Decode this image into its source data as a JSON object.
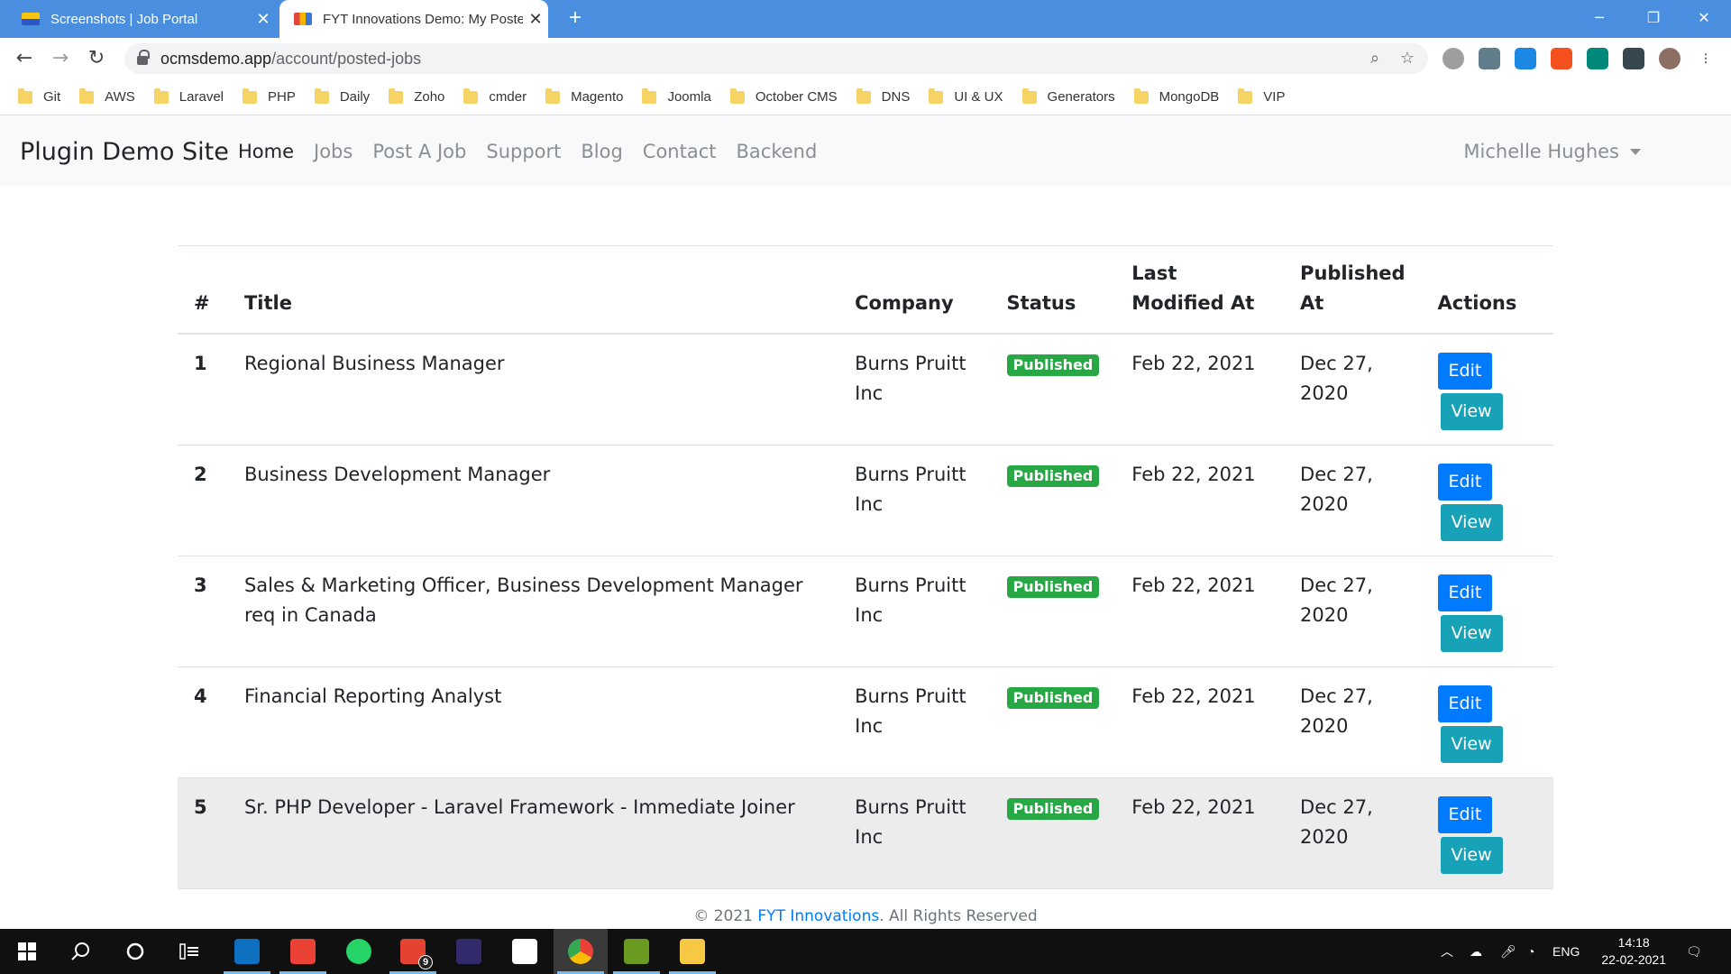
{
  "browser": {
    "tabs": [
      {
        "title": "Screenshots | Job Portal",
        "active": false
      },
      {
        "title": "FYT Innovations Demo: My Poste",
        "active": true
      }
    ],
    "new_tab": "+",
    "window_controls": {
      "minimize": "─",
      "restore": "❐",
      "close": "✕"
    },
    "url_host": "ocmsdemo.app",
    "url_path": "/account/posted-jobs",
    "bookmarks": [
      "Git",
      "AWS",
      "Laravel",
      "PHP",
      "Daily",
      "Zoho",
      "cmder",
      "Magento",
      "Joomla",
      "October CMS",
      "DNS",
      "UI & UX",
      "Generators",
      "MongoDB",
      "VIP"
    ]
  },
  "site": {
    "brand": "Plugin Demo Site",
    "nav": [
      "Home",
      "Jobs",
      "Post A Job",
      "Support",
      "Blog",
      "Contact",
      "Backend"
    ],
    "active_nav": "Home",
    "user": "Michelle Hughes"
  },
  "table": {
    "headers": [
      "#",
      "Title",
      "Company",
      "Status",
      "Last Modified At",
      "Published At",
      "Actions"
    ],
    "rows": [
      {
        "num": "1",
        "title": "Regional Business Manager",
        "company": "Burns Pruitt Inc",
        "status": "Published",
        "modified": "Feb 22, 2021",
        "published": "Dec 27, 2020"
      },
      {
        "num": "2",
        "title": "Business Development Manager",
        "company": "Burns Pruitt Inc",
        "status": "Published",
        "modified": "Feb 22, 2021",
        "published": "Dec 27, 2020"
      },
      {
        "num": "3",
        "title": "Sales & Marketing Officer, Business Development Manager req in Canada",
        "company": "Burns Pruitt Inc",
        "status": "Published",
        "modified": "Feb 22, 2021",
        "published": "Dec 27, 2020"
      },
      {
        "num": "4",
        "title": "Financial Reporting Analyst",
        "company": "Burns Pruitt Inc",
        "status": "Published",
        "modified": "Feb 22, 2021",
        "published": "Dec 27, 2020"
      },
      {
        "num": "5",
        "title": "Sr. PHP Developer - Laravel Framework - Immediate Joiner",
        "company": "Burns Pruitt Inc",
        "status": "Published",
        "modified": "Feb 22, 2021",
        "published": "Dec 27, 2020"
      }
    ],
    "edit_label": "Edit",
    "view_label": "View"
  },
  "footer": {
    "prefix": "© 2021 ",
    "link": "FYT Innovations",
    "suffix": ". All Rights Reserved"
  },
  "taskbar": {
    "language": "ENG",
    "time": "14:18",
    "date": "22-02-2021",
    "badge_count": "9"
  },
  "colors": {
    "chrome_tabstrip": "#4a8fdf",
    "badge_published": "#28a745",
    "btn_edit": "#007bff",
    "btn_view": "#17a2b8"
  }
}
